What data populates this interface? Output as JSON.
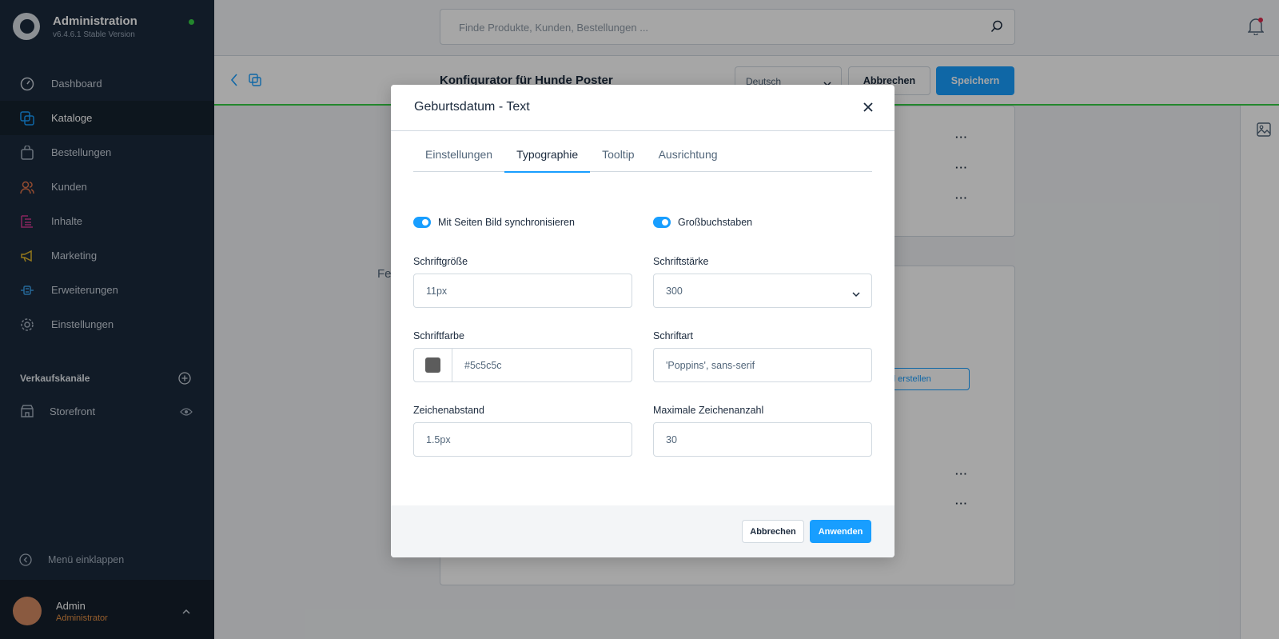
{
  "sidebar": {
    "brand_title": "Administration",
    "brand_version": "v6.4.6.1 Stable Version",
    "items": [
      {
        "label": "Dashboard",
        "icon": "dashboard-icon"
      },
      {
        "label": "Kataloge",
        "icon": "catalog-icon",
        "active": true
      },
      {
        "label": "Bestellungen",
        "icon": "shopping-bag-icon"
      },
      {
        "label": "Kunden",
        "icon": "users-icon"
      },
      {
        "label": "Inhalte",
        "icon": "content-icon"
      },
      {
        "label": "Marketing",
        "icon": "megaphone-icon"
      },
      {
        "label": "Erweiterungen",
        "icon": "plug-icon"
      },
      {
        "label": "Einstellungen",
        "icon": "gear-icon"
      }
    ],
    "sales_channels_title": "Verkaufskanäle",
    "storefront_label": "Storefront",
    "collapse_label": "Menü einklappen",
    "user_name": "Admin",
    "user_role": "Administrator"
  },
  "header": {
    "search_placeholder": "Finde Produkte, Kunden, Bestellungen ..."
  },
  "toolbar": {
    "page_title": "Konfigurator für Hunde Poster",
    "language": "Deutsch",
    "cancel_label": "Abbrechen",
    "save_label": "Speichern"
  },
  "background": {
    "partial_text": "Fel",
    "partial_button": "d erstellen",
    "row_action": "···"
  },
  "modal": {
    "title": "Geburtsdatum - Text",
    "tabs": [
      {
        "label": "Einstellungen"
      },
      {
        "label": "Typographie",
        "active": true
      },
      {
        "label": "Tooltip"
      },
      {
        "label": "Ausrichtung"
      }
    ],
    "sync_switch_label": "Mit Seiten Bild synchronisieren",
    "uppercase_switch_label": "Großbuchstaben",
    "font_size_label": "Schriftgröße",
    "font_size_value": "11px",
    "font_weight_label": "Schriftstärke",
    "font_weight_value": "300",
    "font_color_label": "Schriftfarbe",
    "font_color_value": "#5c5c5c",
    "font_family_label": "Schriftart",
    "font_family_value": "'Poppins', sans-serif",
    "letter_spacing_label": "Zeichenabstand",
    "letter_spacing_value": "1.5px",
    "max_chars_label": "Maximale Zeichenanzahl",
    "max_chars_value": "30",
    "cancel_label": "Abbrechen",
    "apply_label": "Anwenden"
  },
  "colors": {
    "sidebar_bg": "#1b2a3d",
    "accent": "#189eff",
    "status_green": "#37d046",
    "swatch": "#5c5c5c"
  }
}
